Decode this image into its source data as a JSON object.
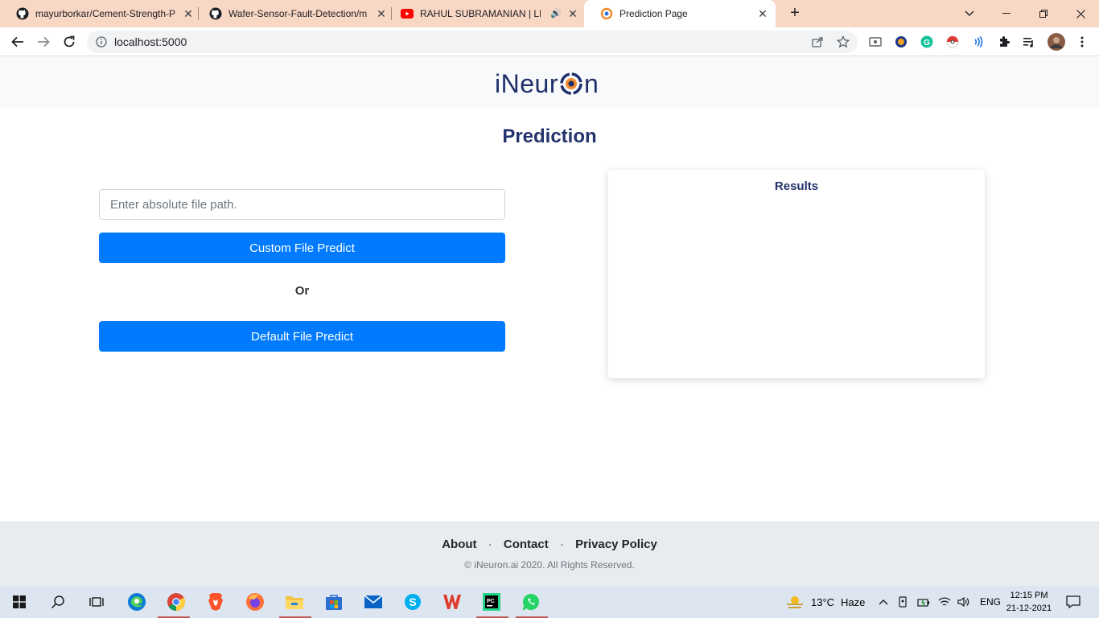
{
  "browser": {
    "tabs": [
      {
        "label": "mayurborkar/Cement-Strength-P",
        "icon": "github-icon"
      },
      {
        "label": "Wafer-Sensor-Fault-Detection/m",
        "icon": "github-icon"
      },
      {
        "label": "RAHUL SUBRAMANIAN | LIV",
        "icon": "youtube-icon"
      },
      {
        "label": "Prediction Page",
        "icon": "ineuron-favicon"
      }
    ],
    "url": "localhost:5000",
    "colors": {
      "tabbar": "#f9d7c5",
      "accent": "#1a73e8"
    }
  },
  "site": {
    "logo_text_pre": "iNeur",
    "logo_text_post": "n",
    "page_title": "Prediction",
    "file_input_placeholder": "Enter absolute file path.",
    "custom_button": "Custom File Predict",
    "or_text": "Or",
    "default_button": "Default File Predict",
    "results_title": "Results",
    "colors": {
      "primary": "#007bff",
      "title": "#23336b"
    }
  },
  "footer": {
    "links": [
      "About",
      "Contact",
      "Privacy Policy"
    ],
    "separator": "·",
    "copyright": "© iNeuron.ai 2020. All Rights Reserved."
  },
  "taskbar": {
    "weather_temp": "13°C",
    "weather_text": "Haze",
    "language": "ENG",
    "time": "12:15 PM",
    "date": "21-12-2021"
  }
}
